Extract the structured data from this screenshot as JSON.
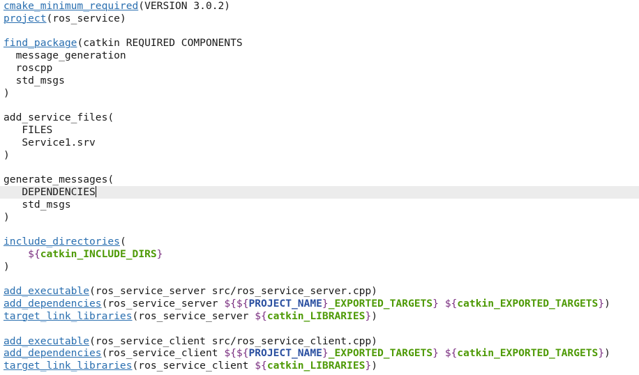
{
  "editor": {
    "lines": [
      [
        {
          "t": "cmake_minimum_required",
          "c": "cmd"
        },
        {
          "t": "(VERSION 3.0.2)",
          "c": "plain"
        }
      ],
      [
        {
          "t": "project",
          "c": "cmd"
        },
        {
          "t": "(ros_service)",
          "c": "plain"
        }
      ],
      [],
      [
        {
          "t": "find_package",
          "c": "cmd"
        },
        {
          "t": "(catkin REQUIRED COMPONENTS",
          "c": "plain"
        }
      ],
      [
        {
          "t": "  message_generation",
          "c": "plain"
        }
      ],
      [
        {
          "t": "  roscpp",
          "c": "plain"
        }
      ],
      [
        {
          "t": "  std_msgs",
          "c": "plain"
        }
      ],
      [
        {
          "t": ")",
          "c": "plain"
        }
      ],
      [],
      [
        {
          "t": "add_service_files(",
          "c": "plain"
        }
      ],
      [
        {
          "t": "   FILES",
          "c": "plain"
        }
      ],
      [
        {
          "t": "   Service1.srv",
          "c": "plain"
        }
      ],
      [
        {
          "t": ")",
          "c": "plain"
        }
      ],
      [],
      [
        {
          "t": "generate_messages(",
          "c": "plain"
        }
      ],
      [
        {
          "t": "   DEPENDENCIES",
          "c": "plain"
        },
        {
          "t": "",
          "c": "cursor"
        }
      ],
      [
        {
          "t": "   std_msgs",
          "c": "plain"
        }
      ],
      [
        {
          "t": ")",
          "c": "plain"
        }
      ],
      [],
      [
        {
          "t": "include_directories",
          "c": "cmd"
        },
        {
          "t": "(",
          "c": "plain"
        }
      ],
      [
        {
          "t": "    ",
          "c": "plain"
        },
        {
          "t": "${",
          "c": "dollar"
        },
        {
          "t": "catkin_INCLUDE_DIRS",
          "c": "var"
        },
        {
          "t": "}",
          "c": "dollar"
        }
      ],
      [
        {
          "t": ")",
          "c": "plain"
        }
      ],
      [],
      [
        {
          "t": "add_executable",
          "c": "cmd"
        },
        {
          "t": "(ros_service_server src/ros_service_server.cpp)",
          "c": "plain"
        }
      ],
      [
        {
          "t": "add_dependencies",
          "c": "cmd"
        },
        {
          "t": "(ros_service_server ",
          "c": "plain"
        },
        {
          "t": "${",
          "c": "dollar"
        },
        {
          "t": "${",
          "c": "dollar2"
        },
        {
          "t": "PROJECT_NAME",
          "c": "varinner"
        },
        {
          "t": "}",
          "c": "dollar2"
        },
        {
          "t": "_EXPORTED_TARGETS",
          "c": "var"
        },
        {
          "t": "}",
          "c": "dollar"
        },
        {
          "t": " ",
          "c": "plain"
        },
        {
          "t": "${",
          "c": "dollar"
        },
        {
          "t": "catkin_EXPORTED_TARGETS",
          "c": "var"
        },
        {
          "t": "}",
          "c": "dollar"
        },
        {
          "t": ")",
          "c": "plain"
        }
      ],
      [
        {
          "t": "target_link_libraries",
          "c": "cmd"
        },
        {
          "t": "(ros_service_server ",
          "c": "plain"
        },
        {
          "t": "${",
          "c": "dollar"
        },
        {
          "t": "catkin_LIBRARIES",
          "c": "var"
        },
        {
          "t": "}",
          "c": "dollar"
        },
        {
          "t": ")",
          "c": "plain"
        }
      ],
      [],
      [
        {
          "t": "add_executable",
          "c": "cmd"
        },
        {
          "t": "(ros_service_client src/ros_service_client.cpp)",
          "c": "plain"
        }
      ],
      [
        {
          "t": "add_dependencies",
          "c": "cmd"
        },
        {
          "t": "(ros_service_client ",
          "c": "plain"
        },
        {
          "t": "${",
          "c": "dollar"
        },
        {
          "t": "${",
          "c": "dollar2"
        },
        {
          "t": "PROJECT_NAME",
          "c": "varinner"
        },
        {
          "t": "}",
          "c": "dollar2"
        },
        {
          "t": "_EXPORTED_TARGETS",
          "c": "var"
        },
        {
          "t": "}",
          "c": "dollar"
        },
        {
          "t": " ",
          "c": "plain"
        },
        {
          "t": "${",
          "c": "dollar"
        },
        {
          "t": "catkin_EXPORTED_TARGETS",
          "c": "var"
        },
        {
          "t": "}",
          "c": "dollar"
        },
        {
          "t": ")",
          "c": "plain"
        }
      ],
      [
        {
          "t": "target_link_libraries",
          "c": "cmd"
        },
        {
          "t": "(ros_service_client ",
          "c": "plain"
        },
        {
          "t": "${",
          "c": "dollar"
        },
        {
          "t": "catkin_LIBRARIES",
          "c": "var"
        },
        {
          "t": "}",
          "c": "dollar"
        },
        {
          "t": ")",
          "c": "plain"
        }
      ]
    ],
    "current_line_index": 15,
    "colors": {
      "command": "#2a6fb0",
      "variable": "#4e9a06",
      "inner_variable": "#2a4fa0",
      "dollar": "#7a2f80",
      "current_line_bg": "#ececec",
      "background": "#ffffff"
    }
  }
}
